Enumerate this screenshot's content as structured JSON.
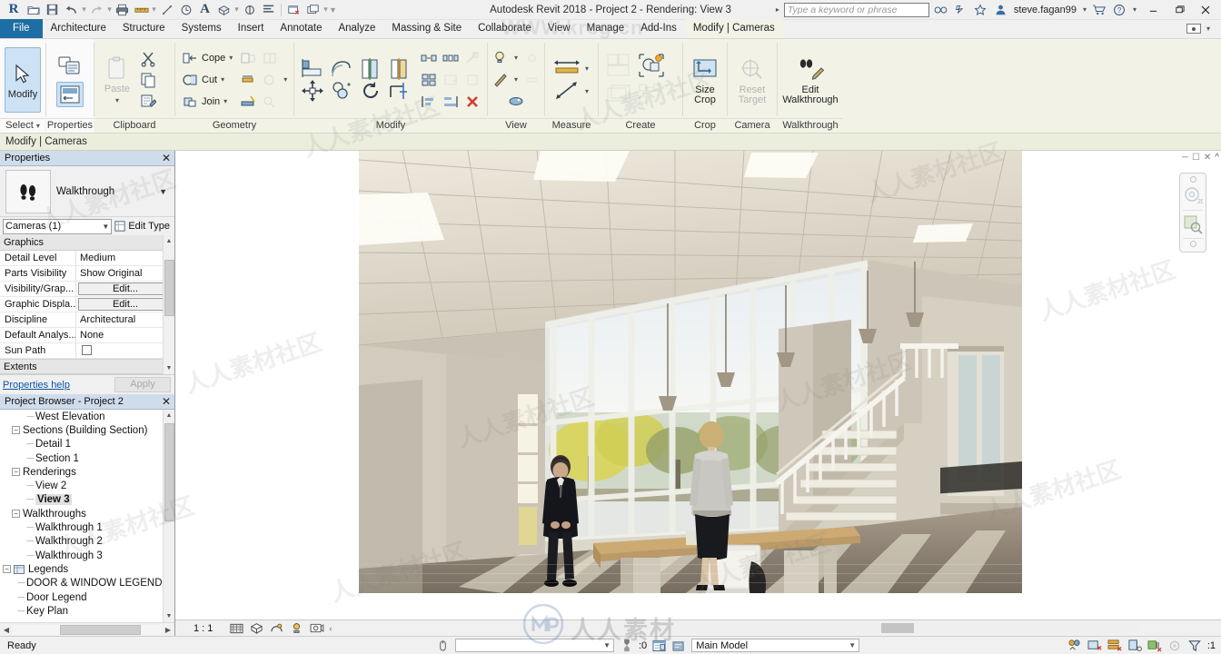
{
  "titlebar": {
    "app_title": "Autodesk Revit 2018 -     Project 2 - Rendering: View 3",
    "logo": "R",
    "quick_access": [
      {
        "name": "open-icon",
        "label": "Open"
      },
      {
        "name": "save-icon",
        "label": "Save"
      },
      {
        "name": "undo-icon",
        "label": "Undo"
      },
      {
        "name": "redo-icon",
        "label": "Redo"
      },
      {
        "name": "print-icon",
        "label": "Print"
      },
      {
        "name": "measure-icon",
        "label": "Measure"
      },
      {
        "name": "aligned-dimension-icon",
        "label": "Aligned Dimension"
      },
      {
        "name": "tag-icon",
        "label": "Tag by Category"
      },
      {
        "name": "text-icon",
        "label": "Text"
      },
      {
        "name": "default-3d-view-icon",
        "label": "Default 3D View"
      },
      {
        "name": "section-icon",
        "label": "Section"
      },
      {
        "name": "thin-lines-icon",
        "label": "Thin Lines"
      },
      {
        "name": "close-hidden-windows-icon",
        "label": "Close Hidden Windows"
      },
      {
        "name": "switch-windows-icon",
        "label": "Switch Windows"
      }
    ],
    "search_placeholder": "Type a keyword or phrase",
    "search_value": "",
    "user": "steve.fagan99",
    "icons": [
      "help-search-icon",
      "exchange-icon",
      "favorites-star-icon",
      "user-icon",
      "cart-icon",
      "help-icon"
    ],
    "window_buttons": [
      "minimize",
      "restore",
      "close"
    ]
  },
  "tabs": [
    {
      "label": "File",
      "type": "file"
    },
    {
      "label": "Architecture",
      "type": "normal"
    },
    {
      "label": "Structure",
      "type": "normal"
    },
    {
      "label": "Systems",
      "type": "normal"
    },
    {
      "label": "Insert",
      "type": "normal"
    },
    {
      "label": "Annotate",
      "type": "normal"
    },
    {
      "label": "Analyze",
      "type": "normal"
    },
    {
      "label": "Massing & Site",
      "type": "normal"
    },
    {
      "label": "Collaborate",
      "type": "normal"
    },
    {
      "label": "View",
      "type": "normal"
    },
    {
      "label": "Manage",
      "type": "normal"
    },
    {
      "label": "Add-Ins",
      "type": "normal"
    },
    {
      "label": "Modify | Cameras",
      "type": "context"
    }
  ],
  "ribbon": {
    "context_label": "Modify | Cameras",
    "panels": [
      {
        "title": "Select",
        "name": "select-panel"
      },
      {
        "title": "Properties",
        "name": "properties-panel"
      },
      {
        "title": "Clipboard",
        "name": "clipboard-panel"
      },
      {
        "title": "Geometry",
        "name": "geometry-panel"
      },
      {
        "title": "Modify",
        "name": "modify-panel"
      },
      {
        "title": "View",
        "name": "view-panel"
      },
      {
        "title": "Measure",
        "name": "measure-panel"
      },
      {
        "title": "Create",
        "name": "create-panel"
      },
      {
        "title": "Crop",
        "name": "crop-panel"
      },
      {
        "title": "Camera",
        "name": "camera-panel"
      },
      {
        "title": "Walkthrough",
        "name": "walkthrough-panel"
      }
    ],
    "select_button": "Modify",
    "paste_label": "Paste",
    "geometry_items": [
      {
        "label": "Cope",
        "disabled": false
      },
      {
        "label": "Cut",
        "disabled": false
      },
      {
        "label": "Join",
        "disabled": false
      }
    ],
    "size_crop": {
      "line1": "Size",
      "line2": "Crop"
    },
    "reset_target": {
      "line1": "Reset",
      "line2": "Target"
    },
    "edit_walkthrough": {
      "line1": "Edit",
      "line2": "Walkthrough"
    }
  },
  "properties_palette": {
    "title": "Properties",
    "type_name": "Walkthrough",
    "thumb_icon": "footsteps-icon",
    "selector_value": "Cameras (1)",
    "edit_type_label": "Edit Type",
    "group_graphics": "Graphics",
    "group_extents": "Extents",
    "rows": [
      {
        "key": "Detail Level",
        "value": "Medium",
        "kind": "text"
      },
      {
        "key": "Parts Visibility",
        "value": "Show Original",
        "kind": "text"
      },
      {
        "key": "Visibility/Grap...",
        "value": "Edit...",
        "kind": "button"
      },
      {
        "key": "Graphic Displa...",
        "value": "Edit...",
        "kind": "button"
      },
      {
        "key": "Discipline",
        "value": "Architectural",
        "kind": "text"
      },
      {
        "key": "Default Analys...",
        "value": "None",
        "kind": "text"
      },
      {
        "key": "Sun Path",
        "value": "",
        "kind": "checkbox"
      }
    ],
    "help_link": "Properties help",
    "apply_label": "Apply"
  },
  "project_browser": {
    "title": "Project Browser - Project 2",
    "nodes": [
      {
        "label": "West Elevation",
        "depth": 2,
        "type": "leaf"
      },
      {
        "label": "Sections (Building Section)",
        "depth": 1,
        "type": "group"
      },
      {
        "label": "Detail 1",
        "depth": 2,
        "type": "leaf"
      },
      {
        "label": "Section 1",
        "depth": 2,
        "type": "leaf"
      },
      {
        "label": "Renderings",
        "depth": 1,
        "type": "group"
      },
      {
        "label": "View 2",
        "depth": 2,
        "type": "leaf"
      },
      {
        "label": "View 3",
        "depth": 2,
        "type": "leaf",
        "selected": true
      },
      {
        "label": "Walkthroughs",
        "depth": 1,
        "type": "group"
      },
      {
        "label": "Walkthrough 1",
        "depth": 2,
        "type": "leaf"
      },
      {
        "label": "Walkthrough 2",
        "depth": 2,
        "type": "leaf"
      },
      {
        "label": "Walkthrough 3",
        "depth": 2,
        "type": "leaf"
      },
      {
        "label": "Legends",
        "depth": 0,
        "type": "group-icon"
      },
      {
        "label": "DOOR & WINDOW LEGEND",
        "depth": 1,
        "type": "leaf"
      },
      {
        "label": "Door Legend",
        "depth": 1,
        "type": "leaf"
      },
      {
        "label": "Key Plan",
        "depth": 1,
        "type": "leaf"
      }
    ]
  },
  "view_control_bar": {
    "scale": "1 : 1",
    "icons": [
      "detail-level-icon",
      "visual-style-icon",
      "sun-path-icon",
      "shadows-icon",
      "render-showcase-icon"
    ],
    "expand": "‹"
  },
  "statusbar": {
    "ready_text": "Ready",
    "filter_value": "",
    "count_icon_label": ":0",
    "worksets_value": "Main Model",
    "filter_badge": ":1",
    "right_icons": [
      "worksharing-display-icon",
      "editing-request-icon",
      "relinquish-icon",
      "reload-latest-icon",
      "synchronize-icon",
      "design-options-icon",
      "filter-icon"
    ]
  },
  "navigation": {
    "steering_wheel_icon": "steering-wheel-icon",
    "zoom_icon": "zoom-region-icon"
  },
  "watermark": {
    "url": "WWW.krcg.cn",
    "text": "人人素材",
    "tiles": "人人素材社区"
  },
  "render_view": {
    "name": "rendering-view-3",
    "description": "Interior architectural rendering – office lobby with curtain wall, staircase, desk, two figures"
  }
}
